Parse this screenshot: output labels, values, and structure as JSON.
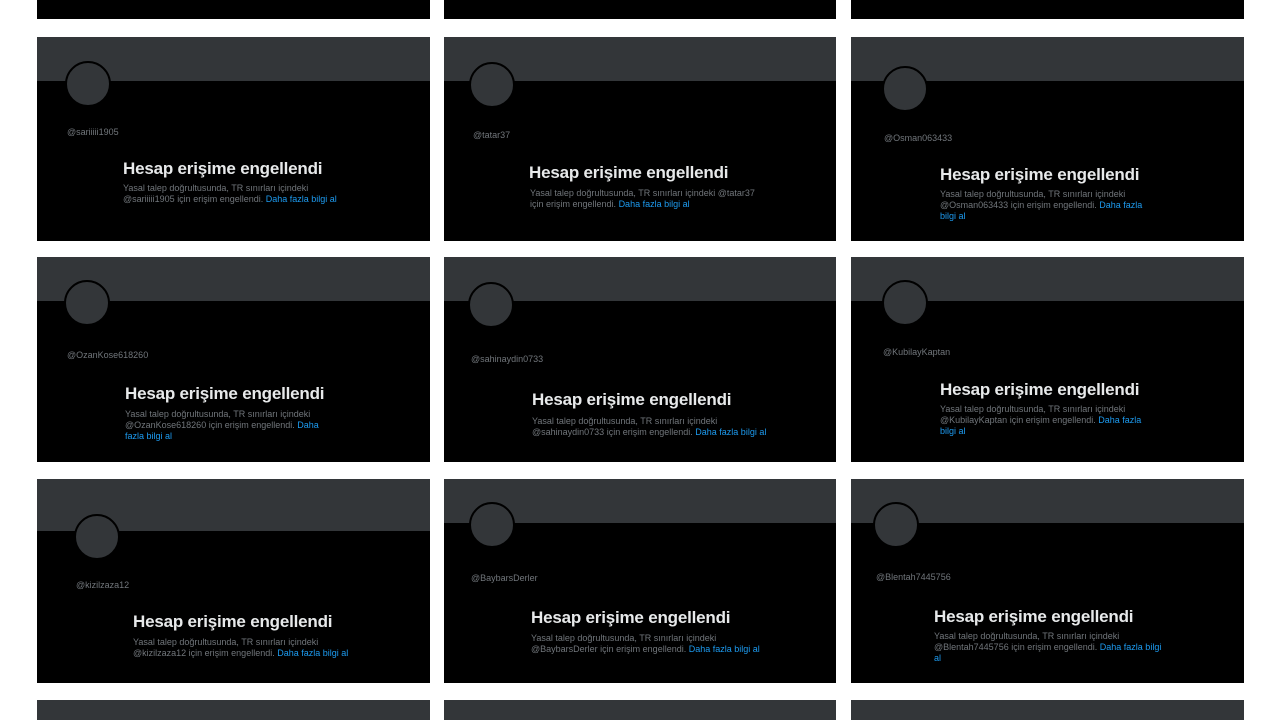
{
  "common": {
    "title": "Hesap erişime engellendi",
    "message_prefix": "Yasal talep doğrultusunda, TR sınırları içindeki",
    "message_suffix": "için erişim engellendi.",
    "learn_more": "Daha fazla bilgi al"
  },
  "cards": [
    {
      "handle": "@sariiiii1905"
    },
    {
      "handle": "@tatar37"
    },
    {
      "handle": "@Osman063433"
    },
    {
      "handle": "@OzanKose618260"
    },
    {
      "handle": "@sahinaydin0733"
    },
    {
      "handle": "@KubilayKaptan"
    },
    {
      "handle": "@kizilzaza12"
    },
    {
      "handle": "@BaybarsDerler"
    },
    {
      "handle": "@Blentah7445756"
    }
  ],
  "colors": {
    "background": "#ffffff",
    "card": "#000000",
    "banner": "#333639",
    "text_primary": "#e7e9ea",
    "text_secondary": "#71767b",
    "link": "#1d9bf0"
  }
}
